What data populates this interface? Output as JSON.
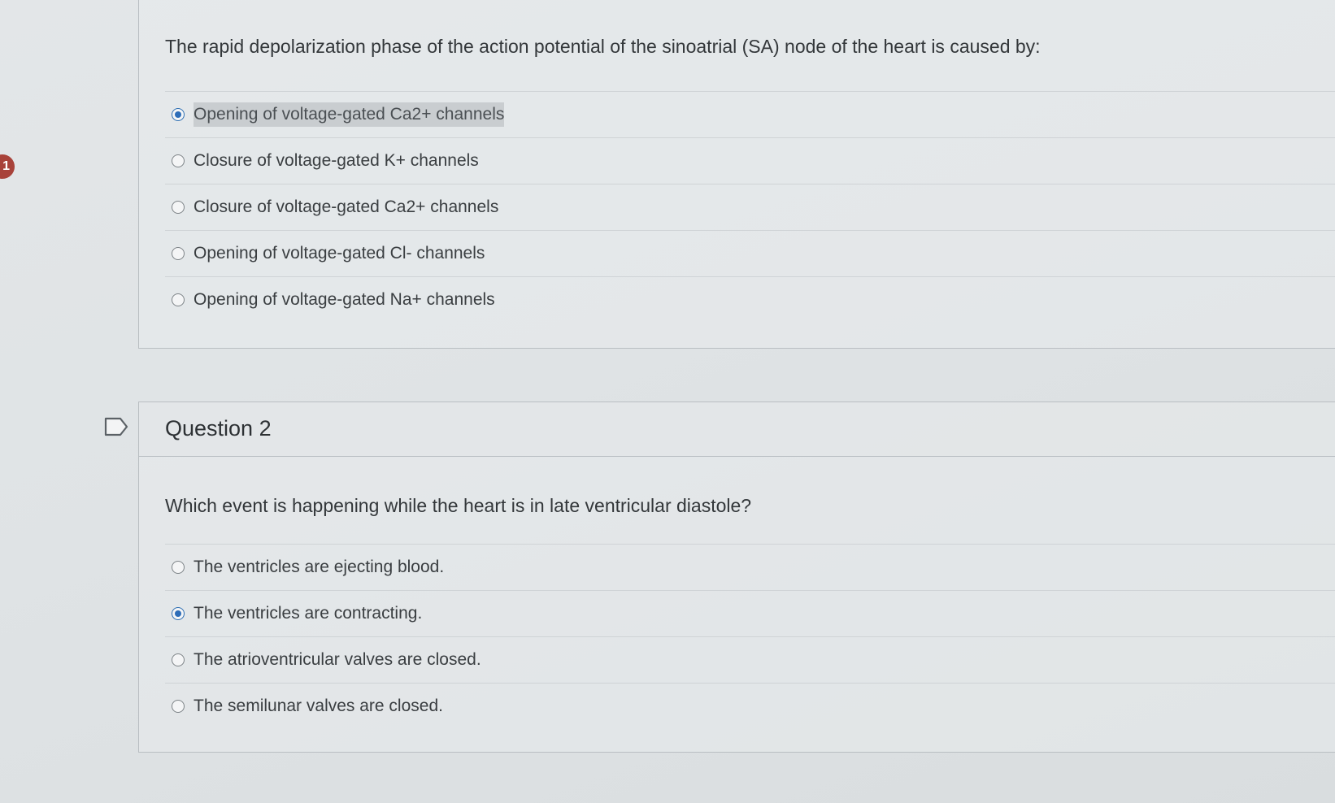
{
  "sidebar": {
    "question_badge": "1"
  },
  "question1": {
    "text": "The rapid depolarization phase of the action potential of the sinoatrial (SA) node of the heart is caused by:",
    "answers": [
      {
        "label": "Opening of voltage-gated Ca2+ channels",
        "selected": true
      },
      {
        "label": "Closure of voltage-gated K+ channels",
        "selected": false
      },
      {
        "label": "Closure of voltage-gated Ca2+ channels",
        "selected": false
      },
      {
        "label": "Opening of voltage-gated Cl- channels",
        "selected": false
      },
      {
        "label": "Opening of voltage-gated Na+ channels",
        "selected": false
      }
    ]
  },
  "question2": {
    "heading": "Question 2",
    "text": "Which event is happening while the heart is in late ventricular diastole?",
    "answers": [
      {
        "label": "The ventricles are ejecting blood.",
        "selected": false
      },
      {
        "label": "The ventricles are contracting.",
        "selected": true
      },
      {
        "label": "The atrioventricular valves are closed.",
        "selected": false
      },
      {
        "label": "The semilunar valves are closed.",
        "selected": false
      }
    ]
  },
  "colors": {
    "selected_radio": "#2d6db8",
    "badge": "#a8423a",
    "card_border": "#b9bec2"
  }
}
